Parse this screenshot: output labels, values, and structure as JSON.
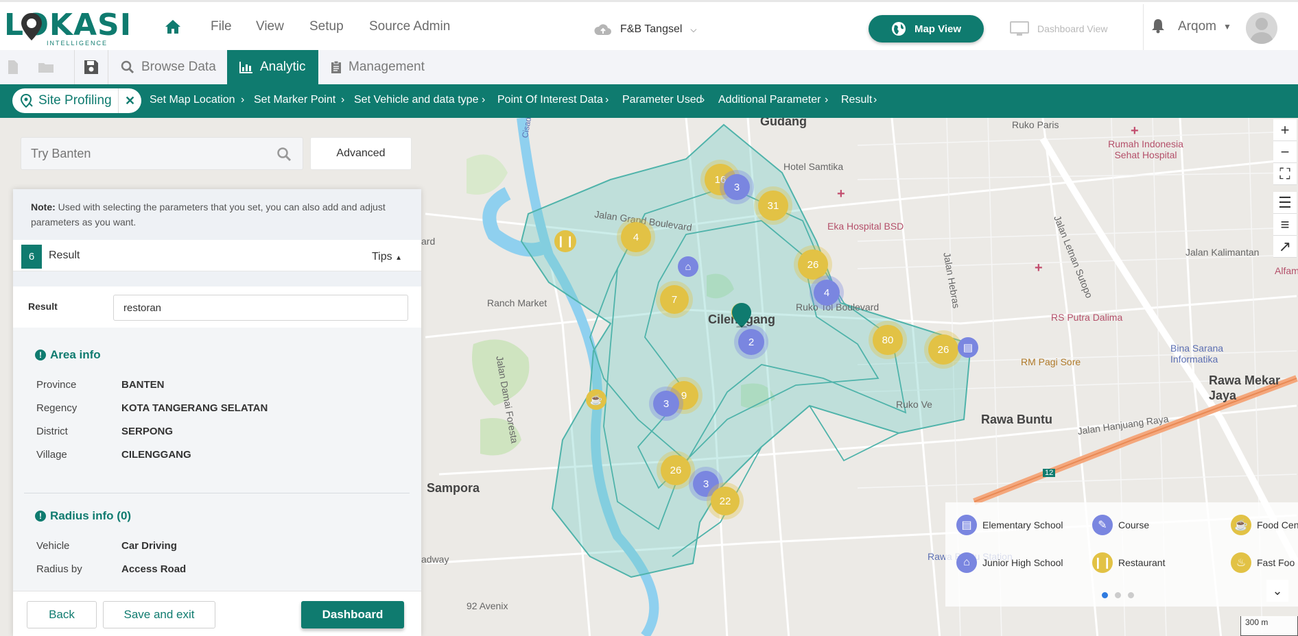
{
  "header": {
    "logo_text": "LOKASI",
    "logo_sub": "INTELLIGENCE",
    "nav": [
      "File",
      "View",
      "Setup",
      "Source Admin"
    ],
    "project": "F&B Tangsel",
    "map_view": "Map View",
    "dashboard_view": "Dashboard View",
    "user": "Arqom"
  },
  "toolbar": {
    "tabs": [
      "Browse Data",
      "Analytic",
      "Management"
    ],
    "active_tab": "Analytic"
  },
  "steps": {
    "chip": "Site Profiling",
    "items": [
      "Set Map Location",
      "Set Marker Point",
      "Set Vehicle and data type",
      "Point Of Interest Data",
      "Parameter Used",
      "Additional Parameter",
      "Result"
    ]
  },
  "search": {
    "placeholder": "Try Banten",
    "advanced": "Advanced"
  },
  "panel": {
    "note_bold": "Note:",
    "note_text": " Used with selecting the parameters that you set, you can also add and adjust parameters as you want.",
    "step_number": "6",
    "step_title": "Result",
    "tips": "Tips",
    "result_label": "Result",
    "result_value": "restoran",
    "area_title": "Area info",
    "area": [
      {
        "k": "Province",
        "v": "BANTEN"
      },
      {
        "k": "Regency",
        "v": "KOTA TANGERANG SELATAN"
      },
      {
        "k": "District",
        "v": "SERPONG"
      },
      {
        "k": "Village",
        "v": "CILENGGANG"
      }
    ],
    "radius_title": "Radius info (0)",
    "radius": [
      {
        "k": "Vehicle",
        "v": "Car Driving"
      },
      {
        "k": "Radius by",
        "v": "Access Road"
      }
    ]
  },
  "footer": {
    "back": "Back",
    "save_exit": "Save and exit",
    "dashboard": "Dashboard"
  },
  "map": {
    "labels": {
      "gudang": "Gudang",
      "ruko_paris": "Ruko Paris",
      "rumah_sakit": "Rumah Indonesia Sehat Hospital",
      "hotel": "Hotel Samtika",
      "eka": "Eka Hospital BSD",
      "jalan_letnan": "Jalan Letnan Sutopo",
      "jalan_kalimantan": "Jalan Kalimantan",
      "alfama": "Alfama",
      "jalan_hebras": "Jalan Hebras",
      "rs_putra": "RS Putra Dalima",
      "rm_pagi": "RM Pagi Sore",
      "bina": "Bina Sarana Informatika",
      "rawa_mekar": "Rawa Mekar Jaya",
      "rawa_buntu": "Rawa Buntu",
      "jalan_hanjuang": "Jalan Hanjuang Raya",
      "ranch": "Ranch Market",
      "jalan_grand": "Jalan Grand Boulevard",
      "cilenggang": "Cilenggang",
      "ruko_boulevard": "Ruko Tol Boulevard",
      "ruko_v": "Ruko Ve",
      "jalan_damai": "Jalan Damai Foresta",
      "cisadane": "Cisadane",
      "sampora": "Sampora",
      "avenix": "92 Avenix",
      "rawa_station": "Rawa Buntu Station",
      "adway": "adway",
      "ard": "ard",
      "road_12": "12"
    },
    "clusters": [
      {
        "n": "16",
        "c": "yellow"
      },
      {
        "n": "3",
        "c": "blue"
      },
      {
        "n": "31",
        "c": "yellow"
      },
      {
        "n": "4",
        "c": "yellow"
      },
      {
        "n": "26",
        "c": "yellow"
      },
      {
        "n": "4",
        "c": "blue"
      },
      {
        "n": "7",
        "c": "yellow"
      },
      {
        "n": "2",
        "c": "blue"
      },
      {
        "n": "80",
        "c": "yellow"
      },
      {
        "n": "26",
        "c": "yellow"
      },
      {
        "n": "9",
        "c": "yellow"
      },
      {
        "n": "3",
        "c": "blue"
      },
      {
        "n": "26",
        "c": "yellow"
      },
      {
        "n": "3",
        "c": "blue"
      },
      {
        "n": "22",
        "c": "yellow"
      }
    ],
    "scale": "300 m"
  },
  "legend": {
    "items": [
      "Elementary School",
      "Course",
      "Food Cen",
      "Junior High School",
      "Restaurant",
      "Fast Foo"
    ]
  },
  "colors": {
    "primary": "#0f7b6f",
    "cluster_yellow": "#e2c245",
    "cluster_blue": "#7a86e0"
  }
}
